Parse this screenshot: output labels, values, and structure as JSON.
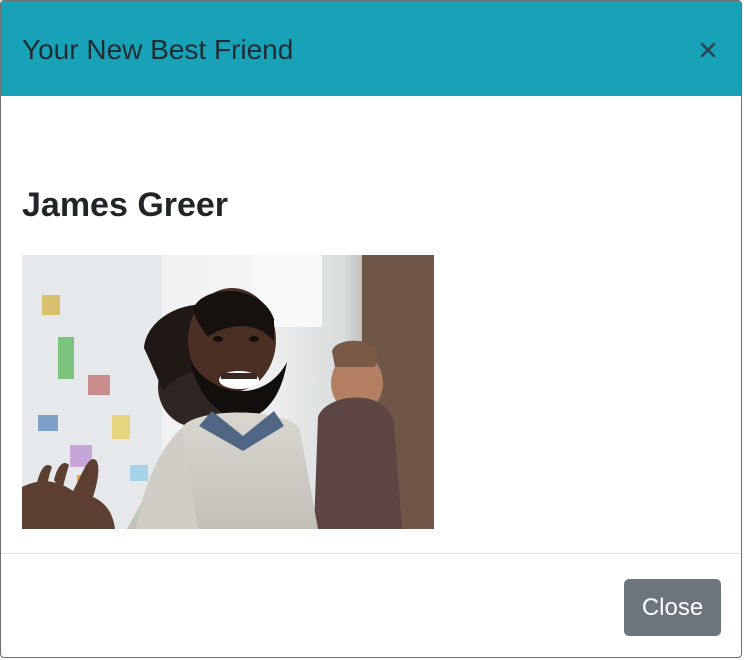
{
  "modal": {
    "title": "Your New Best Friend",
    "close_icon": "close-icon",
    "body": {
      "name": "James Greer",
      "photo_icon": "person-photo"
    },
    "footer": {
      "close_label": "Close"
    }
  },
  "colors": {
    "header_background": "#17a2b8",
    "close_button_background": "#6c757d"
  }
}
